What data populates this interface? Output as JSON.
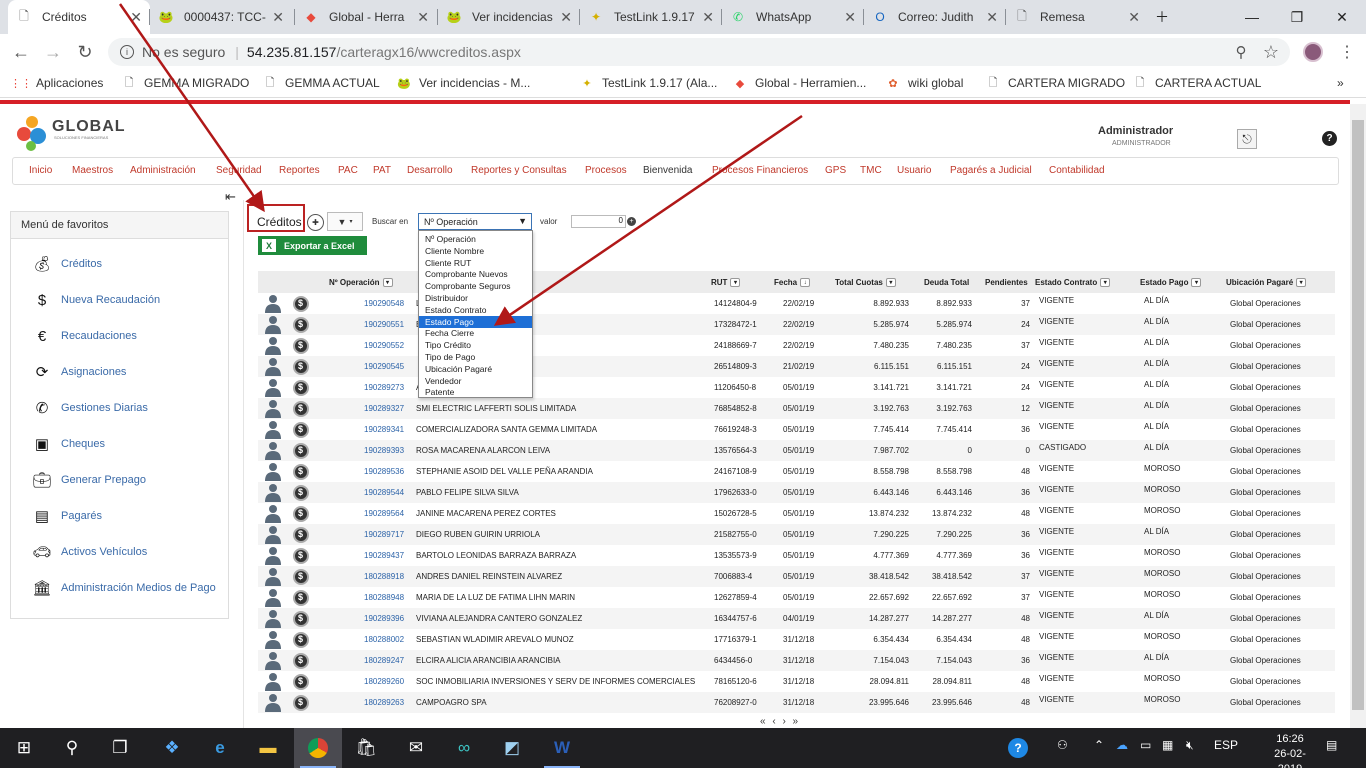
{
  "browser": {
    "tabs": [
      {
        "label": "Créditos",
        "icon": "page-icon",
        "active": true
      },
      {
        "label": "0000437: TCC-",
        "icon": "frog-icon"
      },
      {
        "label": "Global - Herra",
        "icon": "global-icon"
      },
      {
        "label": "Ver incidencias",
        "icon": "frog-icon"
      },
      {
        "label": "TestLink 1.9.17",
        "icon": "testlink-icon"
      },
      {
        "label": "WhatsApp",
        "icon": "whatsapp-icon"
      },
      {
        "label": "Correo: Judith",
        "icon": "outlook-icon"
      },
      {
        "label": "Remesa",
        "icon": "page-icon"
      }
    ],
    "insecure_label": "No es seguro",
    "url_host": "54.235.81.157",
    "url_path": "/carteragx16/wwcreditos.aspx",
    "bookmarks": [
      {
        "label": "Aplicaciones",
        "icon": "apps-grid-icon"
      },
      {
        "label": "GEMMA MIGRADO",
        "icon": "page-icon"
      },
      {
        "label": "GEMMA ACTUAL",
        "icon": "page-icon"
      },
      {
        "label": "Ver incidencias - M...",
        "icon": "frog-icon"
      },
      {
        "label": "TestLink 1.9.17 (Ala...",
        "icon": "testlink-icon"
      },
      {
        "label": "Global - Herramien...",
        "icon": "global-icon"
      },
      {
        "label": "wiki global",
        "icon": "wiki-icon"
      },
      {
        "label": "CARTERA MIGRADO",
        "icon": "page-icon"
      },
      {
        "label": "CARTERA ACTUAL",
        "icon": "page-icon"
      }
    ]
  },
  "header": {
    "logo_text": "GLOBAL",
    "logo_sub": "SOLUCIONES FINANCIERAS",
    "user_name": "Administrador",
    "user_role": "ADMINISTRADOR",
    "help_label": "?"
  },
  "menu": [
    "Inicio",
    "Maestros",
    "Administración",
    "Seguridad",
    "Reportes",
    "PAC",
    "PAT",
    "Desarrollo",
    "Reportes y Consultas",
    "Procesos",
    "Bienvenida",
    "Procesos Financieros",
    "GPS",
    "TMC",
    "Usuario",
    "Pagarés a Judicial",
    "Contabilidad"
  ],
  "favorites": {
    "title": "Menú de favoritos",
    "items": [
      {
        "label": "Créditos",
        "icon": "money-hand-icon"
      },
      {
        "label": "Nueva Recaudación",
        "icon": "coin-add-icon"
      },
      {
        "label": "Recaudaciones",
        "icon": "coin-hand-icon"
      },
      {
        "label": "Asignaciones",
        "icon": "refresh-money-icon"
      },
      {
        "label": "Gestiones Diarias",
        "icon": "phone-icon"
      },
      {
        "label": "Cheques",
        "icon": "cheque-icon"
      },
      {
        "label": "Generar Prepago",
        "icon": "briefcase-icon"
      },
      {
        "label": "Pagarés",
        "icon": "wallet-icon"
      },
      {
        "label": "Activos Vehículos",
        "icon": "car-icon"
      },
      {
        "label": "Administración Medios de Pago",
        "icon": "bank-icon"
      }
    ]
  },
  "toolbar": {
    "title": "Créditos",
    "search_label": "Buscar en",
    "search_selected": "Nº Operación",
    "value_label": "valor",
    "value": "0",
    "export_label": "Exportar a Excel",
    "search_options": [
      "Nº Operación",
      "Cliente Nombre",
      "Cliente RUT",
      "Comprobante Nuevos",
      "Comprobante Seguros",
      "Distribuidor",
      "Estado Contrato",
      "Estado Pago",
      "Fecha Cierre",
      "Tipo Crédito",
      "Tipo de Pago",
      "Ubicación Pagaré",
      "Vendedor",
      "Patente"
    ],
    "highlighted_option": "Estado Pago"
  },
  "table": {
    "headers": {
      "op": "Nº Operación",
      "rut": "RUT",
      "fecha": "Fecha",
      "total": "Total Cuotas",
      "deuda": "Deuda Total",
      "pend": "Pendientes",
      "estado_contrato": "Estado Contrato",
      "estado_pago": "Estado Pago",
      "ubicacion": "Ubicación Pagaré"
    },
    "rows": [
      {
        "op": "190290548",
        "cliente": "LVA",
        "rut": "14124804-9",
        "fecha": "22/02/19",
        "total": "8.892.933",
        "deuda": "8.892.933",
        "pend": "37",
        "ec": "VIGENTE",
        "ep": "AL DÍA",
        "ub": "Global Operaciones"
      },
      {
        "op": "190290551",
        "cliente": "ES",
        "rut": "17328472-1",
        "fecha": "22/02/19",
        "total": "5.285.974",
        "deuda": "5.285.974",
        "pend": "24",
        "ec": "VIGENTE",
        "ep": "AL DÍA",
        "ub": "Global Operaciones"
      },
      {
        "op": "190290552",
        "cliente": "",
        "rut": "24188669-7",
        "fecha": "22/02/19",
        "total": "7.480.235",
        "deuda": "7.480.235",
        "pend": "37",
        "ec": "VIGENTE",
        "ep": "AL DÍA",
        "ub": "Global Operaciones"
      },
      {
        "op": "190290545",
        "cliente": "",
        "rut": "26514809-3",
        "fecha": "21/02/19",
        "total": "6.115.151",
        "deuda": "6.115.151",
        "pend": "24",
        "ec": "VIGENTE",
        "ep": "AL DÍA",
        "ub": "Global Operaciones"
      },
      {
        "op": "190289273",
        "cliente": "ANDOVAL",
        "rut": "11206450-8",
        "fecha": "05/01/19",
        "total": "3.141.721",
        "deuda": "3.141.721",
        "pend": "24",
        "ec": "VIGENTE",
        "ep": "AL DÍA",
        "ub": "Global Operaciones"
      },
      {
        "op": "190289327",
        "cliente": "SMI ELECTRIC LAFFERTI SOLIS LIMITADA",
        "rut": "76854852-8",
        "fecha": "05/01/19",
        "total": "3.192.763",
        "deuda": "3.192.763",
        "pend": "12",
        "ec": "VIGENTE",
        "ep": "AL DÍA",
        "ub": "Global Operaciones"
      },
      {
        "op": "190289341",
        "cliente": "COMERCIALIZADORA SANTA GEMMA LIMITADA",
        "rut": "76619248-3",
        "fecha": "05/01/19",
        "total": "7.745.414",
        "deuda": "7.745.414",
        "pend": "36",
        "ec": "VIGENTE",
        "ep": "AL DÍA",
        "ub": "Global Operaciones"
      },
      {
        "op": "190289393",
        "cliente": "ROSA MACARENA ALARCON LEIVA",
        "rut": "13576564-3",
        "fecha": "05/01/19",
        "total": "7.987.702",
        "deuda": "0",
        "pend": "0",
        "ec": "CASTIGADO",
        "ep": "AL DÍA",
        "ub": "Global Operaciones"
      },
      {
        "op": "190289536",
        "cliente": "STEPHANIE ASOID DEL VALLE PEÑA ARANDIA",
        "rut": "24167108-9",
        "fecha": "05/01/19",
        "total": "8.558.798",
        "deuda": "8.558.798",
        "pend": "48",
        "ec": "VIGENTE",
        "ep": "MOROSO",
        "ub": "Global Operaciones"
      },
      {
        "op": "190289544",
        "cliente": "PABLO FELIPE SILVA SILVA",
        "rut": "17962633-0",
        "fecha": "05/01/19",
        "total": "6.443.146",
        "deuda": "6.443.146",
        "pend": "36",
        "ec": "VIGENTE",
        "ep": "MOROSO",
        "ub": "Global Operaciones"
      },
      {
        "op": "190289564",
        "cliente": "JANINE MACARENA PEREZ CORTES",
        "rut": "15026728-5",
        "fecha": "05/01/19",
        "total": "13.874.232",
        "deuda": "13.874.232",
        "pend": "48",
        "ec": "VIGENTE",
        "ep": "MOROSO",
        "ub": "Global Operaciones"
      },
      {
        "op": "190289717",
        "cliente": "DIEGO RUBEN GUIRIN URRIOLA",
        "rut": "21582755-0",
        "fecha": "05/01/19",
        "total": "7.290.225",
        "deuda": "7.290.225",
        "pend": "36",
        "ec": "VIGENTE",
        "ep": "AL DÍA",
        "ub": "Global Operaciones"
      },
      {
        "op": "190289437",
        "cliente": "BARTOLO LEONIDAS BARRAZA BARRAZA",
        "rut": "13535573-9",
        "fecha": "05/01/19",
        "total": "4.777.369",
        "deuda": "4.777.369",
        "pend": "36",
        "ec": "VIGENTE",
        "ep": "MOROSO",
        "ub": "Global Operaciones"
      },
      {
        "op": "180288918",
        "cliente": "ANDRES DANIEL REINSTEIN ALVAREZ",
        "rut": "7006883-4",
        "fecha": "05/01/19",
        "total": "38.418.542",
        "deuda": "38.418.542",
        "pend": "37",
        "ec": "VIGENTE",
        "ep": "MOROSO",
        "ub": "Global Operaciones"
      },
      {
        "op": "180288948",
        "cliente": "MARIA DE LA LUZ DE FATIMA LIHN MARIN",
        "rut": "12627859-4",
        "fecha": "05/01/19",
        "total": "22.657.692",
        "deuda": "22.657.692",
        "pend": "37",
        "ec": "VIGENTE",
        "ep": "MOROSO",
        "ub": "Global Operaciones"
      },
      {
        "op": "190289396",
        "cliente": "VIVIANA ALEJANDRA CANTERO GONZALEZ",
        "rut": "16344757-6",
        "fecha": "04/01/19",
        "total": "14.287.277",
        "deuda": "14.287.277",
        "pend": "48",
        "ec": "VIGENTE",
        "ep": "AL DÍA",
        "ub": "Global Operaciones"
      },
      {
        "op": "180288002",
        "cliente": "SEBASTIAN WLADIMIR AREVALO MUNOZ",
        "rut": "17716379-1",
        "fecha": "31/12/18",
        "total": "6.354.434",
        "deuda": "6.354.434",
        "pend": "48",
        "ec": "VIGENTE",
        "ep": "MOROSO",
        "ub": "Global Operaciones"
      },
      {
        "op": "180289247",
        "cliente": "ELCIRA ALICIA ARANCIBIA ARANCIBIA",
        "rut": "6434456-0",
        "fecha": "31/12/18",
        "total": "7.154.043",
        "deuda": "7.154.043",
        "pend": "36",
        "ec": "VIGENTE",
        "ep": "AL DÍA",
        "ub": "Global Operaciones"
      },
      {
        "op": "180289260",
        "cliente": "SOC INMOBILIARIA INVERSIONES Y SERV DE INFORMES COMERCIALES",
        "rut": "78165120-6",
        "fecha": "31/12/18",
        "total": "28.094.811",
        "deuda": "28.094.811",
        "pend": "48",
        "ec": "VIGENTE",
        "ep": "MOROSO",
        "ub": "Global Operaciones"
      },
      {
        "op": "180289263",
        "cliente": "CAMPOAGRO SPA",
        "rut": "76208927-0",
        "fecha": "31/12/18",
        "total": "23.995.646",
        "deuda": "23.995.646",
        "pend": "48",
        "ec": "VIGENTE",
        "ep": "MOROSO",
        "ub": "Global Operaciones"
      }
    ],
    "pager": "« ‹ › »"
  },
  "taskbar": {
    "language": "ESP",
    "time": "16:26",
    "date": "26-02-2019"
  },
  "colors": {
    "brand_red": "#d62027",
    "link_blue": "#2c63a8",
    "excel_green": "#1f8c3c",
    "annotation_red": "#b01818"
  }
}
